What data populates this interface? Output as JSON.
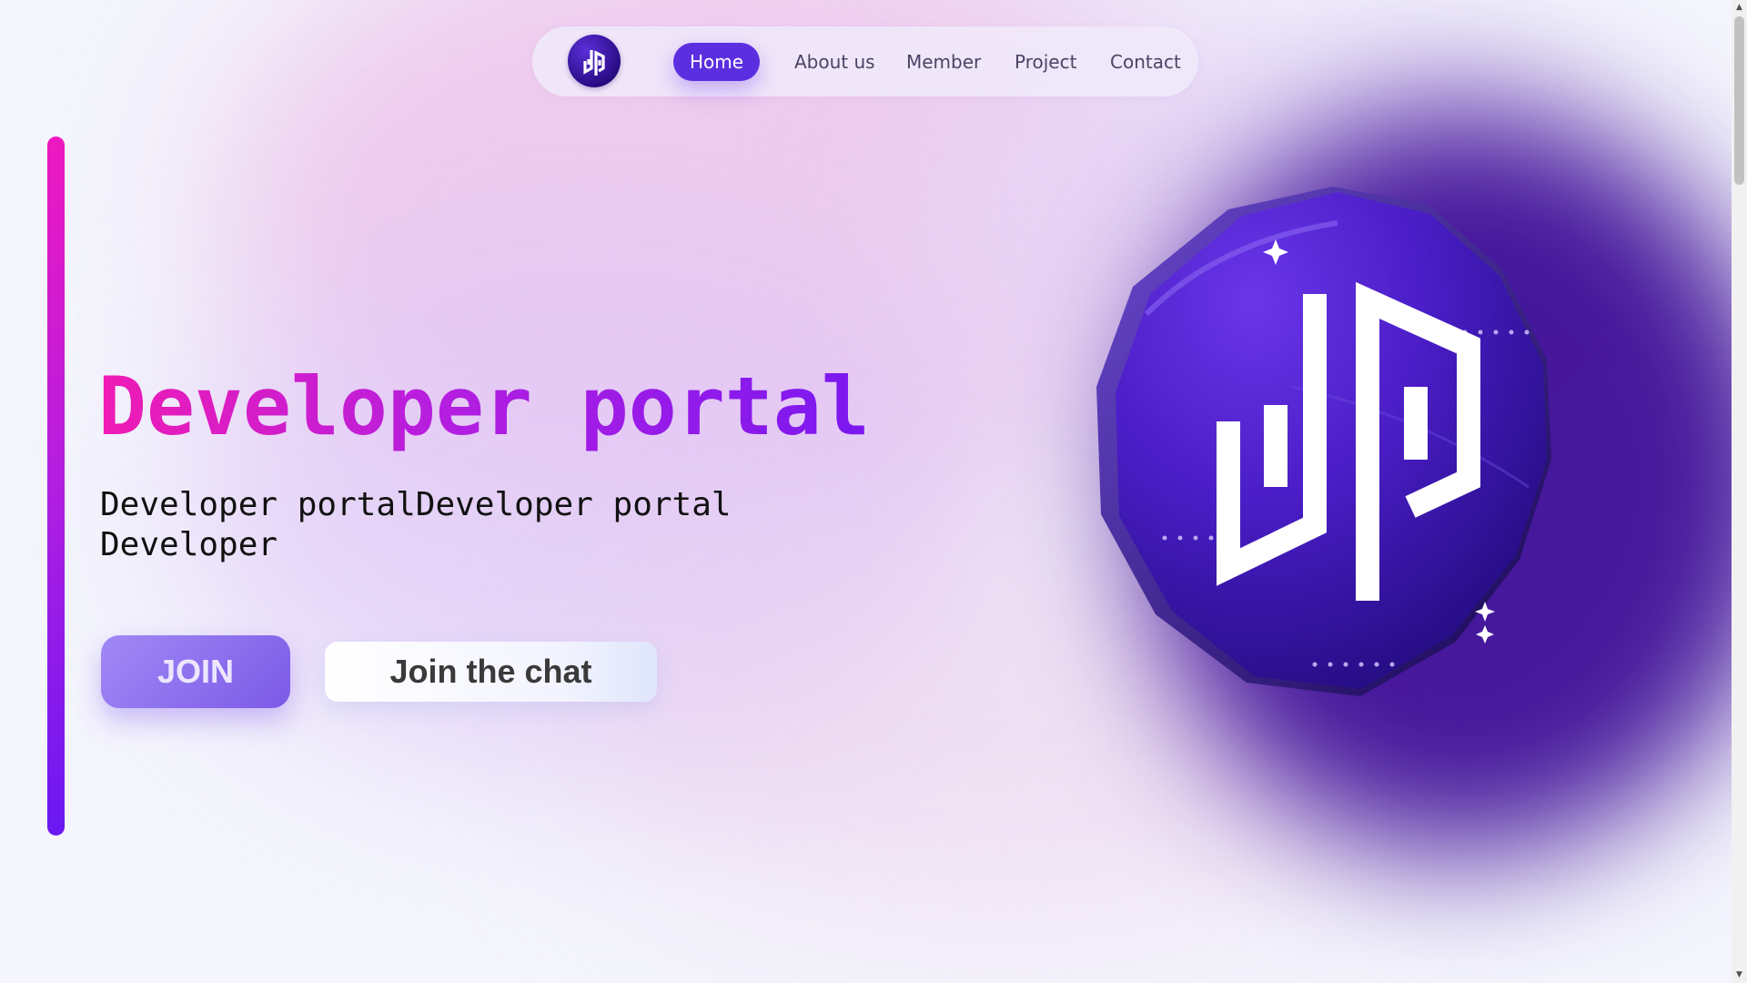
{
  "nav": {
    "items": [
      {
        "label": "Home",
        "active": true
      },
      {
        "label": "About us",
        "active": false
      },
      {
        "label": "Member",
        "active": false
      },
      {
        "label": "Project",
        "active": false
      },
      {
        "label": "Contact",
        "active": false
      }
    ],
    "logo_icon": "dp-logo-icon"
  },
  "hero": {
    "title": "Developer portal",
    "subtitle": "Developer portalDeveloper portal Developer",
    "join_label": "JOIN",
    "chat_label": "Join the chat",
    "coin_icon": "dp-coin-logo-icon"
  },
  "colors": {
    "accent_primary": "#5b2fe0",
    "title_gradient_start": "#f01cb4",
    "title_gradient_end": "#7a18f0",
    "coin_purple": "#3d16b8",
    "background": "#f4f5fd"
  }
}
